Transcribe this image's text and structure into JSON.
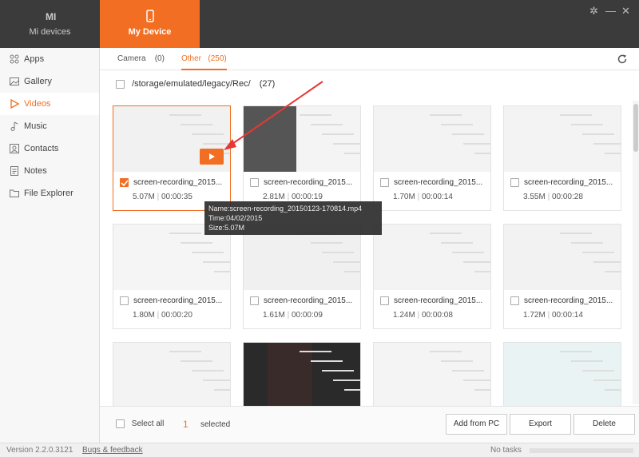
{
  "header": {
    "tabs": [
      {
        "label": "Mi devices",
        "icon": "mi-logo-icon"
      },
      {
        "label": "My Device",
        "icon": "phone-icon"
      }
    ],
    "active_color": "#f26e22"
  },
  "sidebar": {
    "items": [
      {
        "label": "Apps",
        "icon": "apps-grid-icon"
      },
      {
        "label": "Gallery",
        "icon": "image-icon"
      },
      {
        "label": "Videos",
        "icon": "play-icon"
      },
      {
        "label": "Music",
        "icon": "music-note-icon"
      },
      {
        "label": "Contacts",
        "icon": "contact-card-icon"
      },
      {
        "label": "Notes",
        "icon": "note-icon"
      },
      {
        "label": "File Explorer",
        "icon": "folder-icon"
      }
    ],
    "active_index": 2
  },
  "subtabs": [
    {
      "label": "Camera",
      "count": "(0)"
    },
    {
      "label": "Other",
      "count": "(250)"
    }
  ],
  "path": {
    "text": "/storage/emulated/legacy/Rec/",
    "count": "(27)"
  },
  "videos": [
    {
      "name": "screen-recording_2015...",
      "size": "5.07M",
      "duration": "00:00:35",
      "selected": true
    },
    {
      "name": "screen-recording_2015...",
      "size": "2.81M",
      "duration": "00:00:19",
      "selected": false
    },
    {
      "name": "screen-recording_2015...",
      "size": "1.70M",
      "duration": "00:00:14",
      "selected": false
    },
    {
      "name": "screen-recording_2015...",
      "size": "3.55M",
      "duration": "00:00:28",
      "selected": false
    },
    {
      "name": "screen-recording_2015...",
      "size": "1.80M",
      "duration": "00:00:20",
      "selected": false
    },
    {
      "name": "screen-recording_2015...",
      "size": "1.61M",
      "duration": "00:00:09",
      "selected": false
    },
    {
      "name": "screen-recording_2015...",
      "size": "1.24M",
      "duration": "00:00:08",
      "selected": false
    },
    {
      "name": "screen-recording_2015...",
      "size": "1.72M",
      "duration": "00:00:14",
      "selected": false
    },
    {
      "name": "",
      "size": "",
      "duration": "",
      "selected": false
    },
    {
      "name": "",
      "size": "",
      "duration": "",
      "selected": false
    },
    {
      "name": "",
      "size": "",
      "duration": "",
      "selected": false
    },
    {
      "name": "",
      "size": "",
      "duration": "",
      "selected": false
    }
  ],
  "tooltip": {
    "name": "Name:screen-recording_20150123-170814.mp4",
    "time": "Time:04/02/2015",
    "size": "Size:5.07M"
  },
  "bottombar": {
    "select_all": "Select all",
    "selected_count": "1",
    "selected_label": "selected",
    "add_from_pc": "Add from PC",
    "export": "Export",
    "delete": "Delete"
  },
  "statusbar": {
    "version": "Version 2.2.0.3121",
    "feedback": "Bugs & feedback",
    "tasks": "No tasks"
  }
}
